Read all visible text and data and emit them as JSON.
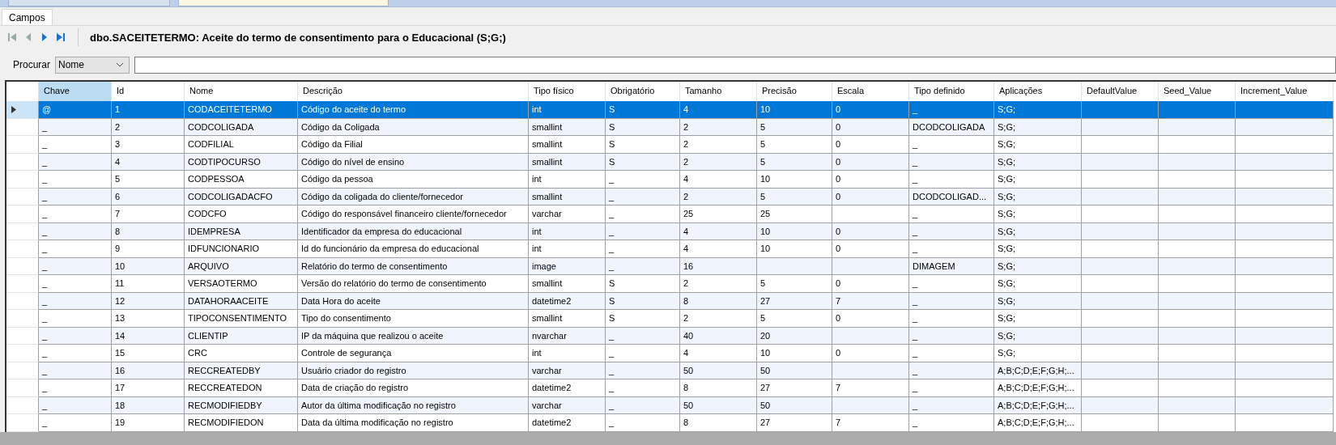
{
  "tabs": [
    {
      "label": "Campos",
      "selected": true
    }
  ],
  "toolbar": {
    "title": "dbo.SACEITETERMO: Aceite do termo de consentimento para o Educacional (S;G;)"
  },
  "search": {
    "label": "Procurar",
    "field": "Nome"
  },
  "table": {
    "columns": [
      {
        "label": "Chave",
        "selected": true
      },
      {
        "label": "Id",
        "selected": false
      },
      {
        "label": "Nome",
        "selected": false
      },
      {
        "label": "Descrição",
        "selected": false
      },
      {
        "label": "Tipo físico",
        "selected": false
      },
      {
        "label": "Obrigatório",
        "selected": false
      },
      {
        "label": "Tamanho",
        "selected": false
      },
      {
        "label": "Precisão",
        "selected": false
      },
      {
        "label": "Escala",
        "selected": false
      },
      {
        "label": "Tipo definido",
        "selected": false
      },
      {
        "label": "Aplicações",
        "selected": false
      },
      {
        "label": "DefaultValue",
        "selected": false
      },
      {
        "label": "Seed_Value",
        "selected": false
      },
      {
        "label": "Increment_Value",
        "selected": false
      }
    ],
    "rows": [
      {
        "selected": true,
        "cells": [
          "@",
          "1",
          "CODACEITETERMO",
          "Código do aceite do termo",
          "int",
          "S",
          "4",
          "10",
          "0",
          "_",
          "S;G;",
          null,
          null,
          null
        ]
      },
      {
        "selected": false,
        "cells": [
          "_",
          "2",
          "CODCOLIGADA",
          "Código da Coligada",
          "smallint",
          "S",
          "2",
          "5",
          "0",
          "DCODCOLIGADA",
          "S;G;",
          null,
          null,
          null
        ]
      },
      {
        "selected": false,
        "cells": [
          "_",
          "3",
          "CODFILIAL",
          "Código da Filial",
          "smallint",
          "S",
          "2",
          "5",
          "0",
          "_",
          "S;G;",
          null,
          null,
          null
        ]
      },
      {
        "selected": false,
        "cells": [
          "_",
          "4",
          "CODTIPOCURSO",
          "Código do nível de ensino",
          "smallint",
          "S",
          "2",
          "5",
          "0",
          "_",
          "S;G;",
          null,
          null,
          null
        ]
      },
      {
        "selected": false,
        "cells": [
          "_",
          "5",
          "CODPESSOA",
          "Código da pessoa",
          "int",
          "_",
          "4",
          "10",
          "0",
          "_",
          "S;G;",
          null,
          null,
          null
        ]
      },
      {
        "selected": false,
        "cells": [
          "_",
          "6",
          "CODCOLIGADACFO",
          "Código da coligada do cliente/fornecedor",
          "smallint",
          "_",
          "2",
          "5",
          "0",
          "DCODCOLIGAD...",
          "S;G;",
          null,
          null,
          null
        ]
      },
      {
        "selected": false,
        "cells": [
          "_",
          "7",
          "CODCFO",
          "Código do responsável financeiro cliente/fornecedor",
          "varchar",
          "_",
          "25",
          "25",
          null,
          "_",
          "S;G;",
          null,
          null,
          null
        ]
      },
      {
        "selected": false,
        "cells": [
          "_",
          "8",
          "IDEMPRESA",
          "Identificador da empresa do educacional",
          "int",
          "_",
          "4",
          "10",
          "0",
          "_",
          "S;G;",
          null,
          null,
          null
        ]
      },
      {
        "selected": false,
        "cells": [
          "_",
          "9",
          "IDFUNCIONARIO",
          "Id do funcionário da empresa do educacional",
          "int",
          "_",
          "4",
          "10",
          "0",
          "_",
          "S;G;",
          null,
          null,
          null
        ]
      },
      {
        "selected": false,
        "cells": [
          "_",
          "10",
          "ARQUIVO",
          "Relatório do termo de consentimento",
          "image",
          "_",
          "16",
          null,
          null,
          "DIMAGEM",
          "S;G;",
          null,
          null,
          null
        ]
      },
      {
        "selected": false,
        "cells": [
          "_",
          "11",
          "VERSAOTERMO",
          "Versão do relatório do termo de consentimento",
          "smallint",
          "S",
          "2",
          "5",
          "0",
          "_",
          "S;G;",
          null,
          null,
          null
        ]
      },
      {
        "selected": false,
        "cells": [
          "_",
          "12",
          "DATAHORAACEITE",
          "Data Hora do aceite",
          "datetime2",
          "S",
          "8",
          "27",
          "7",
          "_",
          "S;G;",
          null,
          null,
          null
        ]
      },
      {
        "selected": false,
        "cells": [
          "_",
          "13",
          "TIPOCONSENTIMENTO",
          "Tipo do consentimento",
          "smallint",
          "S",
          "2",
          "5",
          "0",
          "_",
          "S;G;",
          null,
          null,
          null
        ]
      },
      {
        "selected": false,
        "cells": [
          "_",
          "14",
          "CLIENTIP",
          "IP da máquina que realizou o aceite",
          "nvarchar",
          "_",
          "40",
          "20",
          null,
          "_",
          "S;G;",
          null,
          null,
          null
        ]
      },
      {
        "selected": false,
        "cells": [
          "_",
          "15",
          "CRC",
          "Controle de segurança",
          "int",
          "_",
          "4",
          "10",
          "0",
          "_",
          "S;G;",
          null,
          null,
          null
        ]
      },
      {
        "selected": false,
        "cells": [
          "_",
          "16",
          "RECCREATEDBY",
          "Usuário criador do registro",
          "varchar",
          "_",
          "50",
          "50",
          null,
          "_",
          "A;B;C;D;E;F;G;H;...",
          null,
          null,
          null
        ]
      },
      {
        "selected": false,
        "cells": [
          "_",
          "17",
          "RECCREATEDON",
          "Data de criação do registro",
          "datetime2",
          "_",
          "8",
          "27",
          "7",
          "_",
          "A;B;C;D;E;F;G;H;...",
          null,
          null,
          null
        ]
      },
      {
        "selected": false,
        "cells": [
          "_",
          "18",
          "RECMODIFIEDBY",
          "Autor da última modificação no registro",
          "varchar",
          "_",
          "50",
          "50",
          null,
          "_",
          "A;B;C;D;E;F;G;H;...",
          null,
          null,
          null
        ]
      },
      {
        "selected": false,
        "cells": [
          "_",
          "19",
          "RECMODIFIEDON",
          "Data da última modificação no registro",
          "datetime2",
          "_",
          "8",
          "27",
          "7",
          "_",
          "A;B;C;D;E;F;G;H;...",
          null,
          null,
          null
        ]
      }
    ]
  }
}
